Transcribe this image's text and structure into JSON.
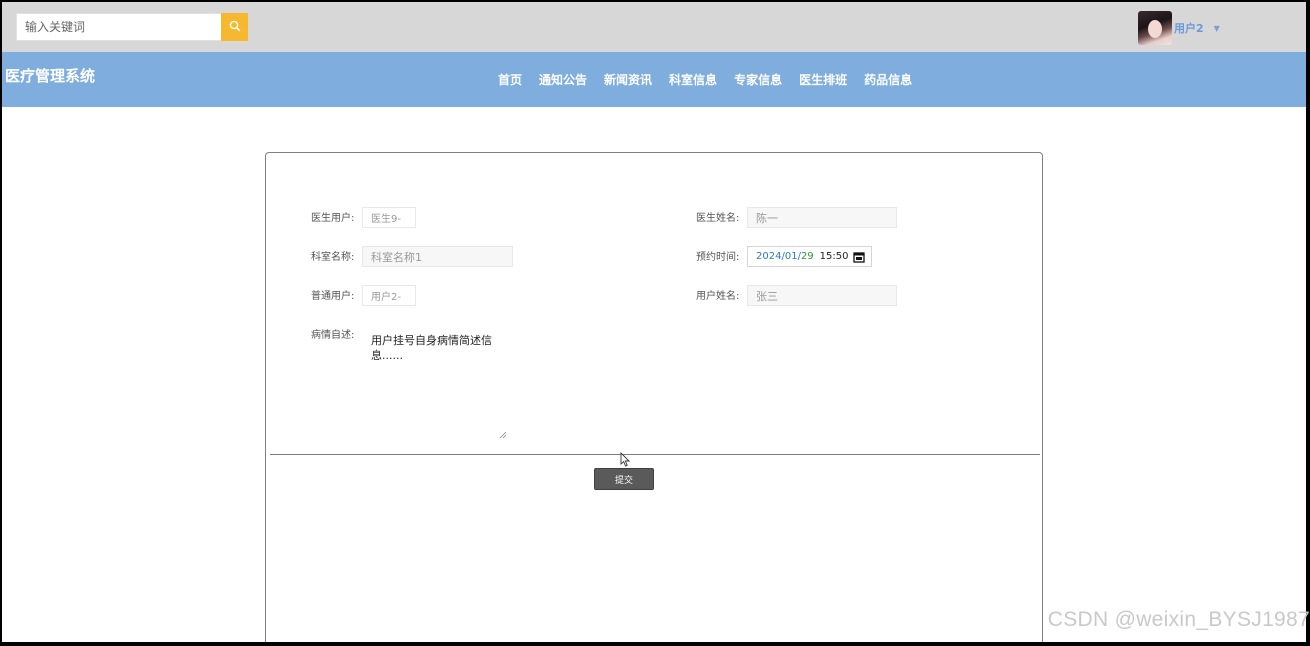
{
  "search": {
    "placeholder": "输入关键词"
  },
  "user": {
    "name": "用户2"
  },
  "logo": "医疗管理系统",
  "nav": {
    "items": [
      "首页",
      "通知公告",
      "新闻资讯",
      "科室信息",
      "专家信息",
      "医生排班",
      "药品信息"
    ]
  },
  "form": {
    "doctor_account_label": "医生用户:",
    "doctor_account_value": "医生9-",
    "doctor_name_label": "医生姓名:",
    "doctor_name_value": "陈一",
    "dept_label": "科室名称:",
    "dept_value": "科室名称1",
    "appointment_label": "预约时间:",
    "appointment": {
      "year": "2024",
      "month": "01",
      "day": "29",
      "time": "15:50"
    },
    "user_account_label": "普通用户:",
    "user_account_value": "用户2-",
    "user_name_label": "用户姓名:",
    "user_name_value": "张三",
    "condition_label": "病情自述:",
    "condition_value": "用户挂号自身病情简述信息......",
    "submit_label": "提交"
  },
  "watermark": "CSDN @weixin_BYSJ1987",
  "colors": {
    "topbar": "#d7d7d7",
    "navbar": "#7eadde",
    "search_button": "#f5b82e",
    "submit_button": "#5a5a5a"
  }
}
